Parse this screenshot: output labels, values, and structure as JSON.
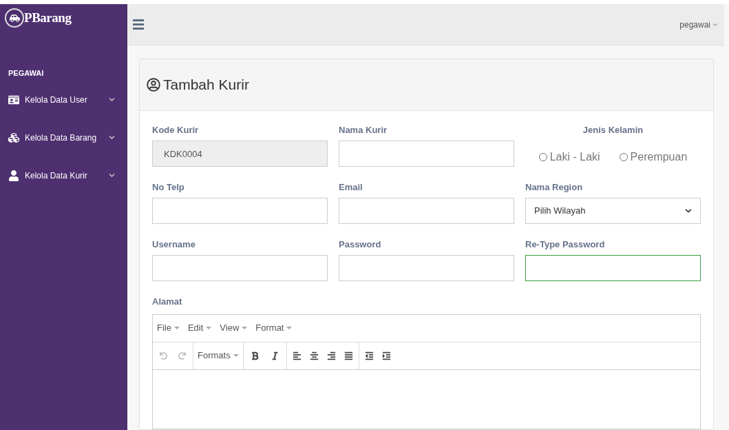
{
  "brand": {
    "name": "PBarang"
  },
  "sidebar": {
    "section": "PEGAWAI",
    "items": [
      {
        "label": "Kelola Data User",
        "expanded": false
      },
      {
        "label": "Kelola Data Barang",
        "expanded": false
      },
      {
        "label": "Kelola Data Kurir",
        "expanded": false
      }
    ]
  },
  "topbar": {
    "user": "pegawai"
  },
  "card": {
    "title": "Tambah Kurir"
  },
  "fields": [
    {
      "kind": "readonly",
      "label": "Kode Kurir",
      "value": "KDK0004",
      "focused": false
    },
    {
      "kind": "input",
      "label": "Nama Kurir",
      "focused": false
    },
    {
      "kind": "radio",
      "label": "Jenis Kelamin",
      "options": [
        {
          "label": "Laki - Laki",
          "selected": false
        },
        {
          "label": "Perempuan",
          "selected": false
        }
      ]
    },
    {
      "kind": "input",
      "label": "No Telp",
      "focused": false
    },
    {
      "kind": "input",
      "label": "Email",
      "focused": false
    },
    {
      "kind": "select",
      "label": "Nama Region",
      "value": "Pilih Wilayah",
      "focused": false
    },
    {
      "kind": "input",
      "label": "Username",
      "focused": false
    },
    {
      "kind": "input",
      "label": "Password",
      "focused": false
    },
    {
      "kind": "input",
      "label": "Re-Type Password",
      "focused": true
    }
  ],
  "alamat": {
    "label": "Alamat",
    "menus": [
      "File",
      "Edit",
      "View",
      "Format"
    ],
    "formats": "Formats"
  }
}
